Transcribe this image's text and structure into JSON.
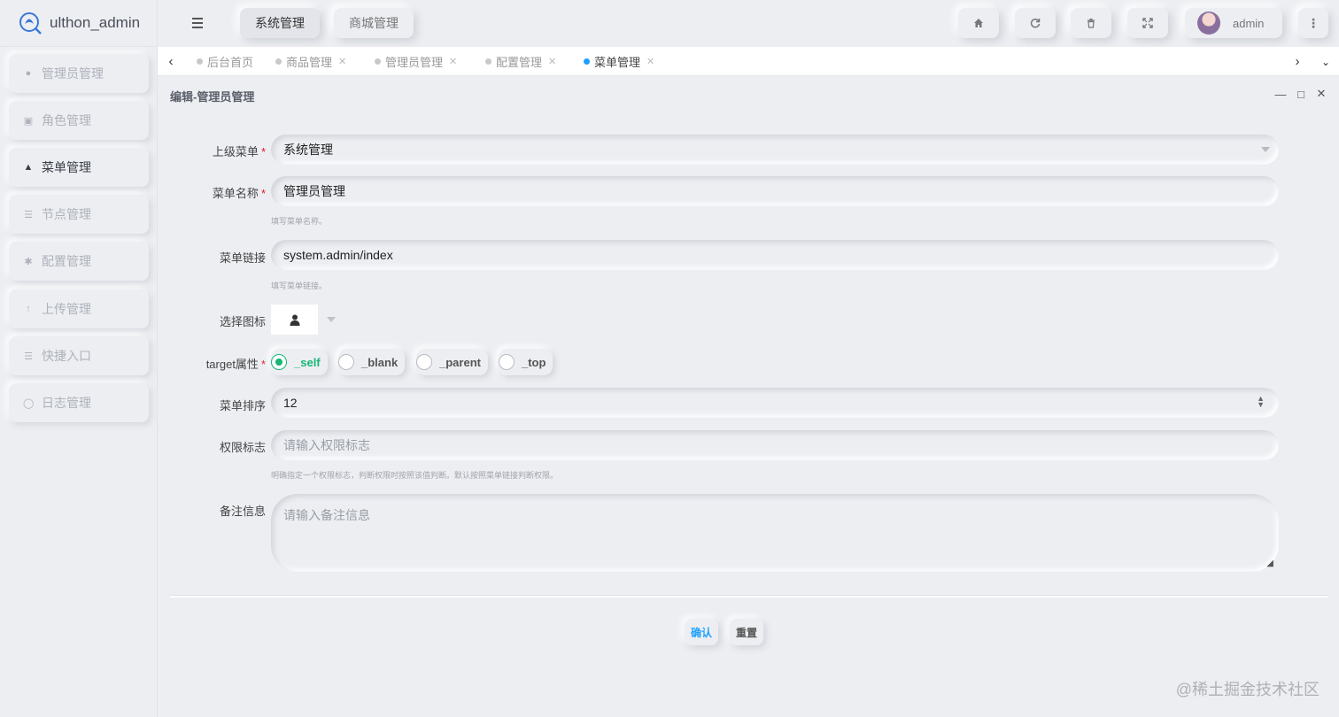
{
  "app": {
    "name": "ulthon_admin"
  },
  "topnav": [
    {
      "label": "系统管理",
      "active": true
    },
    {
      "label": "商城管理",
      "active": false
    }
  ],
  "toolbar_icons": [
    "home-icon",
    "refresh-icon",
    "trash-icon",
    "fullscreen-icon",
    "more-icon"
  ],
  "user": {
    "name": "admin"
  },
  "sidebar": {
    "items": [
      {
        "label": "管理员管理",
        "icon": "user-icon",
        "active": false
      },
      {
        "label": "角色管理",
        "icon": "role-icon",
        "active": false
      },
      {
        "label": "菜单管理",
        "icon": "tree-icon",
        "active": true
      },
      {
        "label": "节点管理",
        "icon": "list-icon",
        "active": false
      },
      {
        "label": "配置管理",
        "icon": "gear-icon",
        "active": false
      },
      {
        "label": "上传管理",
        "icon": "upload-icon",
        "active": false
      },
      {
        "label": "快捷入口",
        "icon": "list-icon",
        "active": false
      },
      {
        "label": "日志管理",
        "icon": "log-icon",
        "active": false
      }
    ]
  },
  "tabs": [
    {
      "label": "后台首页",
      "closable": false,
      "active": false
    },
    {
      "label": "商品管理",
      "closable": true,
      "active": false
    },
    {
      "label": "管理员管理",
      "closable": true,
      "active": false
    },
    {
      "label": "配置管理",
      "closable": true,
      "active": false
    },
    {
      "label": "菜单管理",
      "closable": true,
      "active": true
    }
  ],
  "panel": {
    "title": "编辑-管理员管理"
  },
  "form": {
    "parent_menu": {
      "label": "上级菜单",
      "value": "系统管理",
      "required": true
    },
    "menu_name": {
      "label": "菜单名称",
      "value": "管理员管理",
      "required": true,
      "hint": "填写菜单名称。"
    },
    "menu_link": {
      "label": "菜单链接",
      "value": "system.admin/index",
      "hint": "填写菜单链接。"
    },
    "icon": {
      "label": "选择图标",
      "value": "user-icon"
    },
    "target": {
      "label": "target属性",
      "required": true,
      "options": [
        "_self",
        "_blank",
        "_parent",
        "_top"
      ],
      "selected": "_self"
    },
    "sort": {
      "label": "菜单排序",
      "value": "12"
    },
    "auth": {
      "label": "权限标志",
      "placeholder": "请输入权限标志",
      "hint": "明确指定一个权限标志，判断权限时按照该值判断。默认按照菜单链接判断权限。"
    },
    "remark": {
      "label": "备注信息",
      "placeholder": "请输入备注信息"
    }
  },
  "buttons": {
    "confirm": "确认",
    "reset": "重置"
  },
  "colors": {
    "accent": "#1e9fff",
    "success": "#16b777",
    "required": "#e0191f",
    "background": "#eceef2"
  },
  "watermark": "@稀土掘金技术社区"
}
